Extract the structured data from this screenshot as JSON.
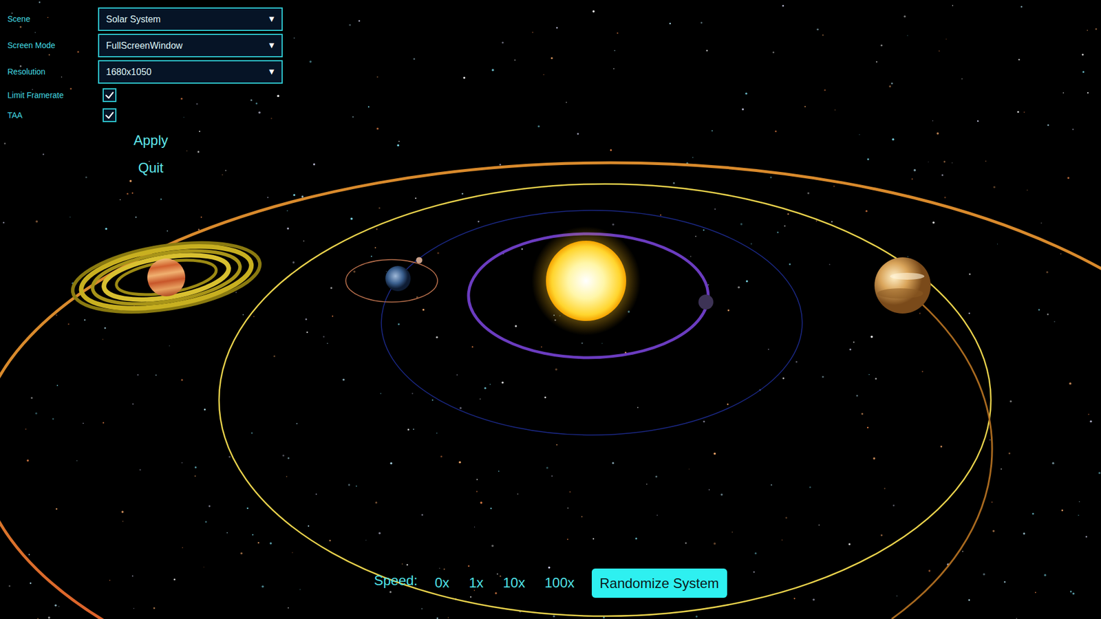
{
  "settings": {
    "fields": [
      {
        "label": "Scene",
        "kind": "dropdown",
        "value": "Solar System",
        "arrow": "▼"
      },
      {
        "label": "Screen Mode",
        "kind": "dropdown",
        "value": "FullScreenWindow",
        "arrow": "▼"
      },
      {
        "label": "Resolution",
        "kind": "dropdown",
        "value": "1680x1050",
        "arrow": "▼"
      },
      {
        "label": "Limit Framerate",
        "kind": "checkbox",
        "checked": true
      },
      {
        "label": "TAA",
        "kind": "checkbox",
        "checked": true
      }
    ],
    "buttons": [
      "Apply",
      "Quit"
    ]
  },
  "speed": {
    "label": "Speed:",
    "options": [
      {
        "label": "0x",
        "selected": false
      },
      {
        "label": "1x",
        "selected": false
      },
      {
        "label": "10x",
        "selected": false
      },
      {
        "label": "100x",
        "selected": false
      }
    ]
  },
  "randomize": {
    "label": "Randomize System",
    "highlighted": true
  },
  "orbits": [
    {
      "color": "#6b3cc0"
    },
    {
      "color": "#1c2a8c"
    },
    {
      "color": "#e9d24c"
    },
    {
      "color": "#d98a2c"
    },
    {
      "color": "#a8691f"
    },
    {
      "color": "#c27550"
    }
  ]
}
